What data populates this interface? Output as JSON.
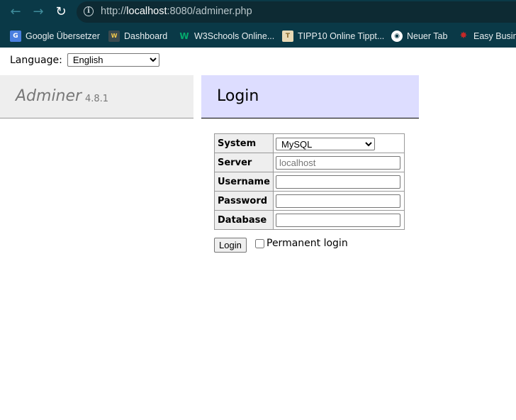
{
  "browser": {
    "url_prefix": "http://",
    "url_host": "localhost",
    "url_rest": ":8080/adminer.php",
    "bookmarks": [
      {
        "label": "Google Übersetzer",
        "icon": "google-translate-icon"
      },
      {
        "label": "Dashboard",
        "icon": "dashboard-icon"
      },
      {
        "label": "W3Schools Online...",
        "icon": "w3schools-icon"
      },
      {
        "label": "TIPP10 Online Tippt...",
        "icon": "tipp10-icon"
      },
      {
        "label": "Neuer Tab",
        "icon": "new-tab-icon"
      },
      {
        "label": "Easy Busine",
        "icon": "easy-business-icon"
      }
    ]
  },
  "page": {
    "language_label": "Language:",
    "language_value": "English",
    "brand_name": "Adminer",
    "brand_version": "4.8.1",
    "heading": "Login",
    "form": {
      "system_label": "System",
      "system_value": "MySQL",
      "server_label": "Server",
      "server_placeholder": "localhost",
      "username_label": "Username",
      "username_value": "",
      "password_label": "Password",
      "password_value": "",
      "database_label": "Database",
      "database_value": "",
      "login_button": "Login",
      "permanent_label": "Permanent login"
    }
  },
  "colors": {
    "chrome_bg": "#0a3947",
    "brand_bg": "#eeeeee",
    "heading_bg": "#ddddff"
  }
}
